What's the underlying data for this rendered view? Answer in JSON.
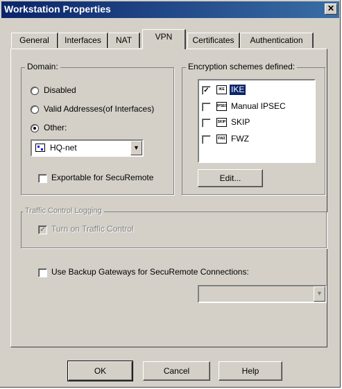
{
  "window": {
    "title": "Workstation Properties"
  },
  "tabs": [
    "General",
    "Interfaces",
    "NAT",
    "VPN",
    "Certificates",
    "Authentication"
  ],
  "active_tab": "VPN",
  "domain": {
    "label": "Domain:",
    "options": [
      "Disabled",
      "Valid Addresses(of Interfaces)",
      "Other:"
    ],
    "selected": "Other:",
    "other_value": "HQ-net",
    "exportable_label": "Exportable for SecuRemote",
    "exportable_checked": false
  },
  "encryption": {
    "label": "Encryption schemes defined:",
    "schemes": [
      {
        "name": "IKE",
        "icon_text": "IKE",
        "checked": true,
        "selected": true
      },
      {
        "name": "Manual IPSEC",
        "icon_text": "IPSEC",
        "checked": false,
        "selected": false
      },
      {
        "name": "SKIP",
        "icon_text": "SKIP",
        "checked": false,
        "selected": false
      },
      {
        "name": "FWZ",
        "icon_text": "FWZ",
        "checked": false,
        "selected": false
      }
    ],
    "edit_label": "Edit..."
  },
  "traffic": {
    "label": "Traffic Control Logging",
    "turn_on_label": "Turn on Traffic Control",
    "checked": true,
    "enabled": false
  },
  "backup": {
    "label": "Use Backup Gateways for SecuRemote Connections:",
    "checked": false,
    "value": ""
  },
  "buttons": {
    "ok": "OK",
    "cancel": "Cancel",
    "help": "Help"
  },
  "icons": {
    "close": "close-icon",
    "network": "network-object-icon",
    "dropdown": "chevron-down-icon"
  },
  "colors": {
    "titlebar": "#0a246a",
    "selection": "#0a246a",
    "face": "#d4d0c8"
  }
}
